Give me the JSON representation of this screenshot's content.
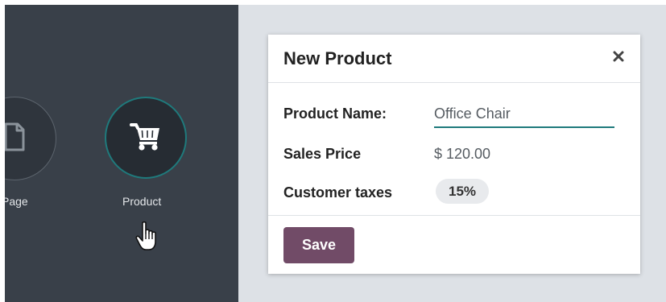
{
  "apps": {
    "page": {
      "label": "Page",
      "icon": "page-icon"
    },
    "product": {
      "label": "Product",
      "icon": "cart-icon",
      "accent": "#1f7a7c"
    }
  },
  "dialog": {
    "title": "New Product",
    "close_icon": "close-icon",
    "fields": {
      "product_name": {
        "label": "Product Name:",
        "value": "Office Chair"
      },
      "sales_price": {
        "label": "Sales Price",
        "value": "$ 120.00"
      },
      "customer_taxes": {
        "label": "Customer taxes",
        "value": "15%"
      }
    },
    "save_label": "Save"
  },
  "colors": {
    "sidebar_bg": "#394049",
    "overlay_bg": "#dde1e6",
    "primary": "#714b67",
    "input_focus": "#1f7a7c"
  }
}
